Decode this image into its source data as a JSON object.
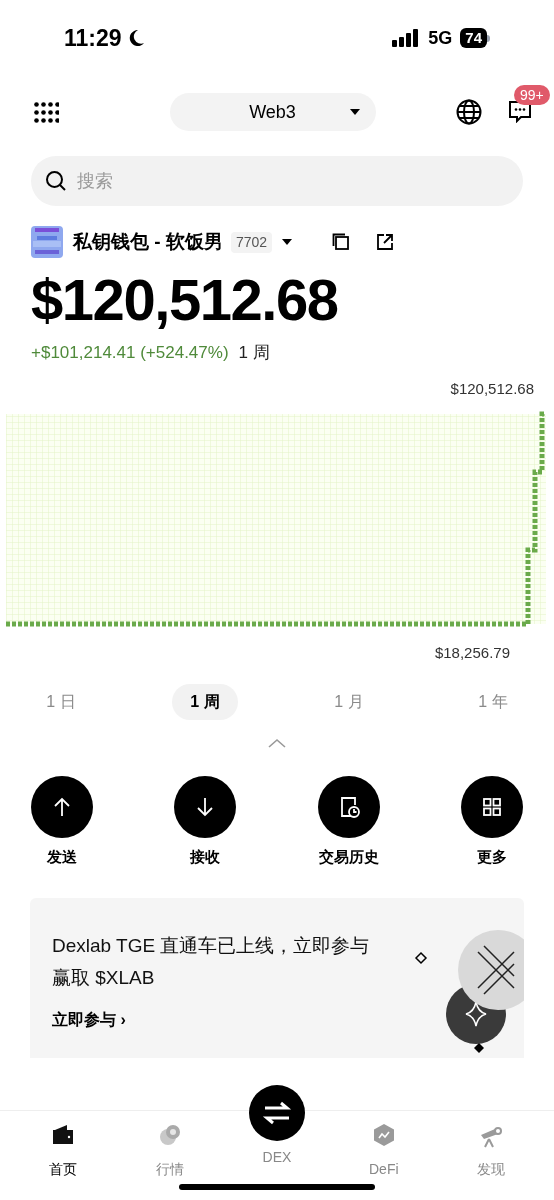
{
  "status_bar": {
    "time": "11:29",
    "network": "5G",
    "battery": "74"
  },
  "header": {
    "switcher": "Web3",
    "badge": "99+"
  },
  "search": {
    "placeholder": "搜索"
  },
  "wallet": {
    "name": "私钥钱包 - 软饭男",
    "tag": "7702"
  },
  "balance": {
    "amount": "$120,512.68",
    "change": "+$101,214.41 (+524.47%)",
    "period": "1 周"
  },
  "chart": {
    "max_label": "$120,512.68",
    "min_label": "$18,256.79"
  },
  "ranges": [
    {
      "label": "1 日",
      "selected": false
    },
    {
      "label": "1 周",
      "selected": true
    },
    {
      "label": "1 月",
      "selected": false
    },
    {
      "label": "1 年",
      "selected": false
    }
  ],
  "actions": [
    {
      "kind": "send",
      "label": "发送"
    },
    {
      "kind": "receive",
      "label": "接收"
    },
    {
      "kind": "history",
      "label": "交易历史"
    },
    {
      "kind": "more",
      "label": "更多"
    }
  ],
  "banner": {
    "text": "Dexlab TGE 直通车已上线，立即参与赢取 $XLAB",
    "link": "立即参与 ›"
  },
  "tab_bar": [
    {
      "kind": "home",
      "label": "首页",
      "selected": true
    },
    {
      "kind": "market",
      "label": "行情",
      "selected": false
    },
    {
      "kind": "dex",
      "label": "DEX",
      "selected": false
    },
    {
      "kind": "defi",
      "label": "DeFi",
      "selected": false
    },
    {
      "kind": "discover",
      "label": "发现",
      "selected": false
    }
  ]
}
